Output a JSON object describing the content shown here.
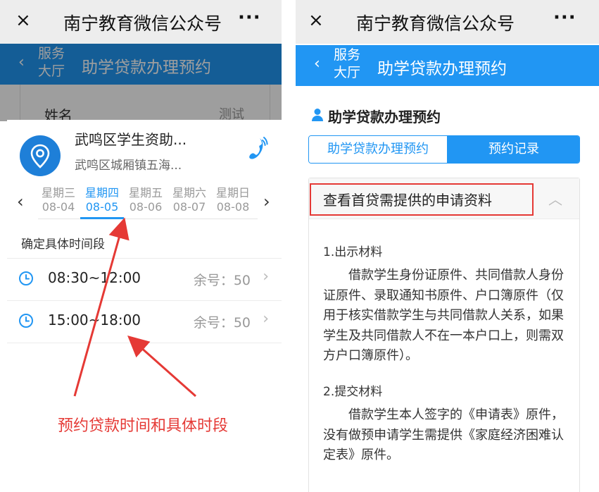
{
  "left": {
    "wechat": {
      "close": "×",
      "title": "南宁教育微信公众号",
      "more": "···"
    },
    "nav": {
      "back": "‹",
      "service_line1": "服务",
      "service_line2": "大厅",
      "title": "助学贷款办理预约"
    },
    "background_form": {
      "name_label": "姓名",
      "name_value": "测试"
    },
    "institution": {
      "name": "武鸣区学生资助...",
      "address": "武鸣区城厢镇五海..."
    },
    "week": {
      "prev": "‹",
      "next": "›",
      "days": [
        {
          "weekday": "星期三",
          "date": "08-04"
        },
        {
          "weekday": "星期四",
          "date": "08-05"
        },
        {
          "weekday": "星期五",
          "date": "08-06"
        },
        {
          "weekday": "星期六",
          "date": "08-07"
        },
        {
          "weekday": "星期日",
          "date": "08-08"
        }
      ],
      "selected_index": 1
    },
    "period_label": "确定具体时间段",
    "slots": [
      {
        "time": "08:30~12:00",
        "remain": "余号：50"
      },
      {
        "time": "15:00~18:00",
        "remain": "余号：50"
      }
    ],
    "annotation_caption": "预约贷款时间和具体时段"
  },
  "right": {
    "wechat": {
      "close": "×",
      "title": "南宁教育微信公众号",
      "more": "···"
    },
    "nav": {
      "back": "‹",
      "service_line1": "服务",
      "service_line2": "大厅",
      "title": "助学贷款办理预约"
    },
    "section_title": "助学贷款办理预约",
    "tabs": {
      "apply": "助学贷款办理预约",
      "records": "预约记录"
    },
    "accordion": {
      "title": "查看首贷需提供的申请资料",
      "caret": "︿",
      "sections": [
        {
          "heading": "1.出示材料",
          "text": "借款学生身份证原件、共同借款人身份证原件、录取通知书原件、户口簿原件（仅用于核实借款学生与共同借款人关系，如果学生及共同借款人不在一本户口上，则需双方户口簿原件）。"
        },
        {
          "heading": "2.提交材料",
          "text": "借款学生本人签字的《申请表》原件，没有做预申请学生需提供《家庭经济困难认定表》原件。"
        }
      ]
    }
  },
  "colors": {
    "brand_blue": "#2196f3",
    "annotation_red": "#e53935",
    "wechat_bar": "#ededed"
  }
}
